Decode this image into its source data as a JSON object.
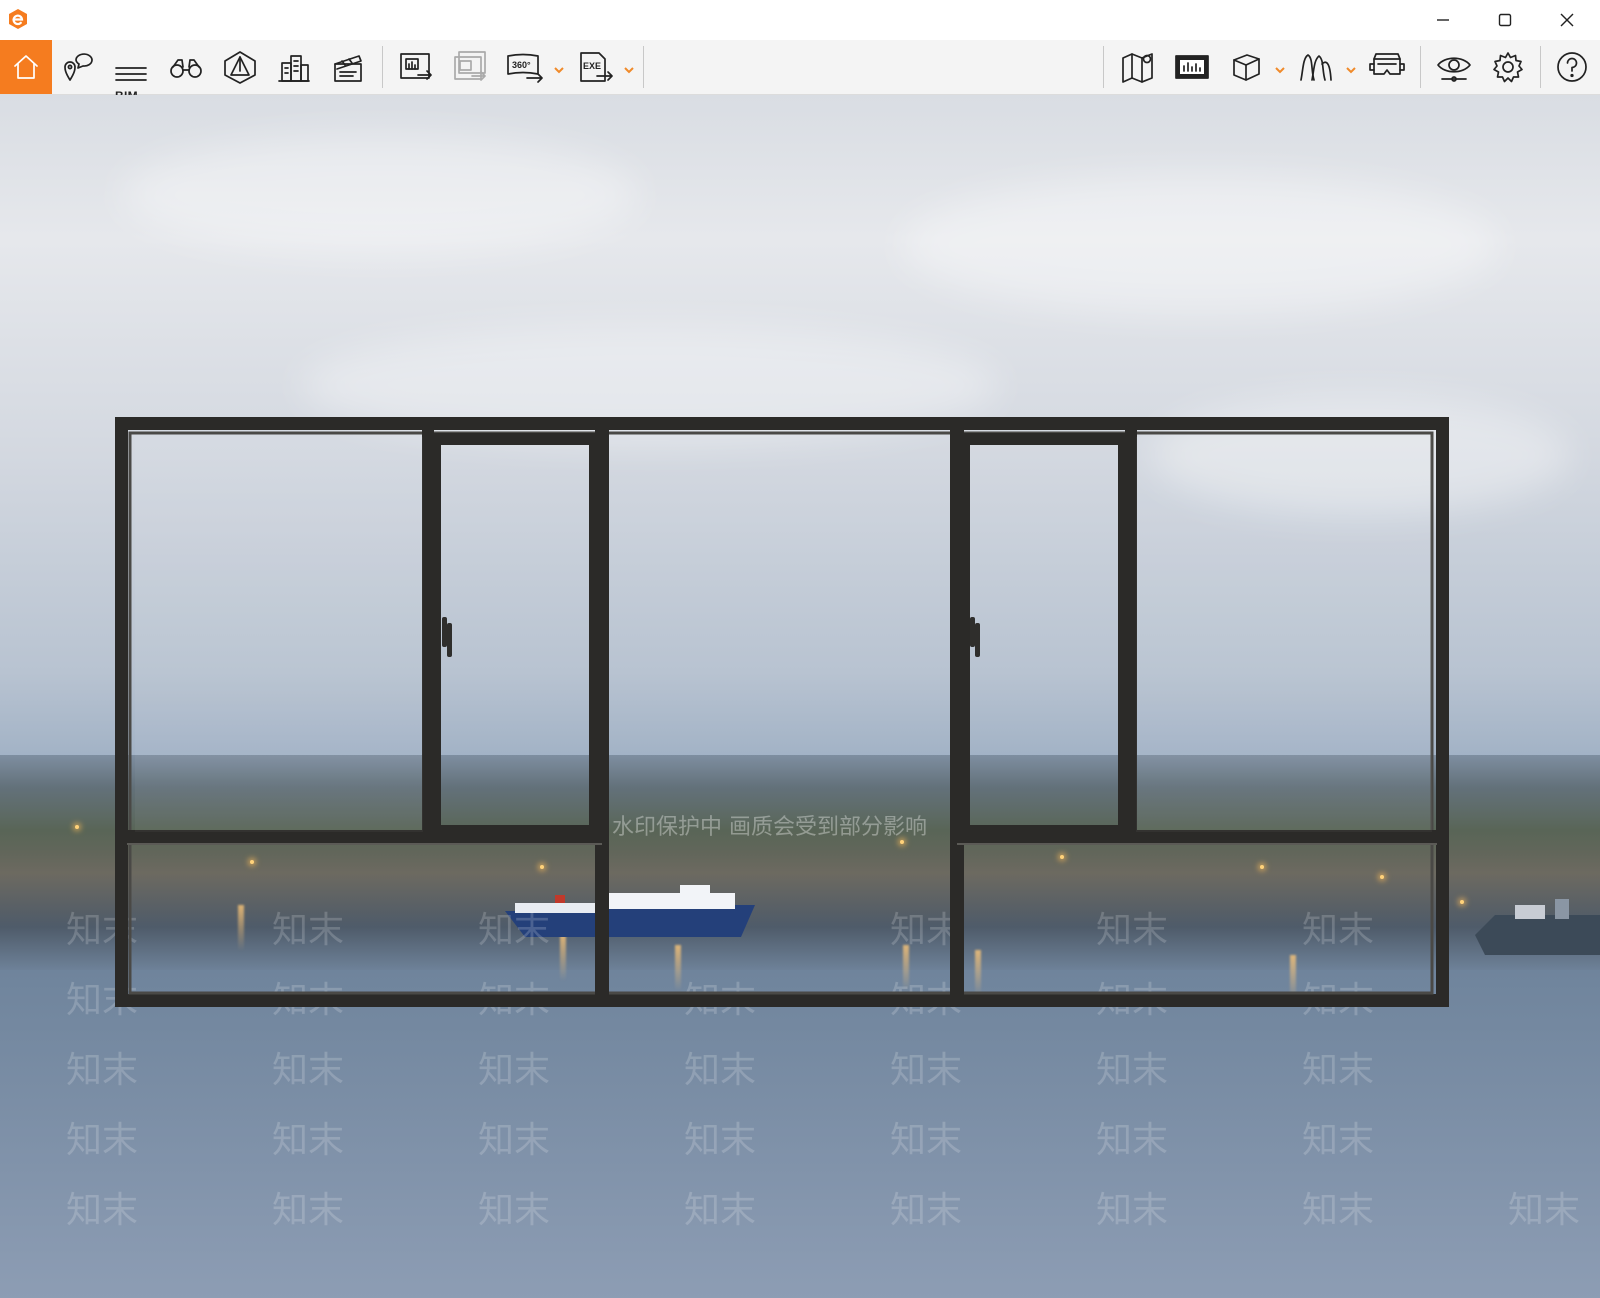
{
  "app": {
    "logo_icon": "app-e-logo-icon",
    "accent": "#f57c1f"
  },
  "window_controls": {
    "minimize_icon": "minimize-icon",
    "maximize_icon": "maximize-icon",
    "close_icon": "close-icon"
  },
  "toolbar": {
    "left": [
      {
        "name": "home",
        "icon": "home-icon",
        "active": true
      },
      {
        "name": "location-chat",
        "icon": "location-chat-icon"
      },
      {
        "name": "bim",
        "icon": "bim-icon",
        "label": "BIM"
      },
      {
        "name": "binoculars",
        "icon": "binoculars-icon"
      },
      {
        "name": "scene-structure",
        "icon": "tetrahedron-icon"
      },
      {
        "name": "buildings",
        "icon": "buildings-icon"
      },
      {
        "name": "animation",
        "icon": "clapperboard-icon"
      },
      {
        "name": "export-image",
        "icon": "export-image-icon"
      },
      {
        "name": "batch-export",
        "icon": "batch-export-icon"
      },
      {
        "name": "export-360",
        "icon": "export-360-icon",
        "label": "360°",
        "dropdown": true
      },
      {
        "name": "export-exe",
        "icon": "export-exe-icon",
        "label": "EXE",
        "dropdown": true
      }
    ],
    "collapse_icon": "chevron-up-icon",
    "right": [
      {
        "name": "map",
        "icon": "map-icon"
      },
      {
        "name": "panel",
        "icon": "dashboard-icon"
      },
      {
        "name": "cube",
        "icon": "cube-icon",
        "dropdown": true
      },
      {
        "name": "material",
        "icon": "material-icon",
        "dropdown": true
      },
      {
        "name": "vr",
        "icon": "vr-headset-icon"
      },
      {
        "name": "view",
        "icon": "eye-icon"
      },
      {
        "name": "settings",
        "icon": "gear-icon"
      },
      {
        "name": "help",
        "icon": "help-icon"
      }
    ]
  },
  "viewport": {
    "watermark_text": "知末",
    "watermark_notice": "水印保护中 画质会受到部分影响"
  }
}
